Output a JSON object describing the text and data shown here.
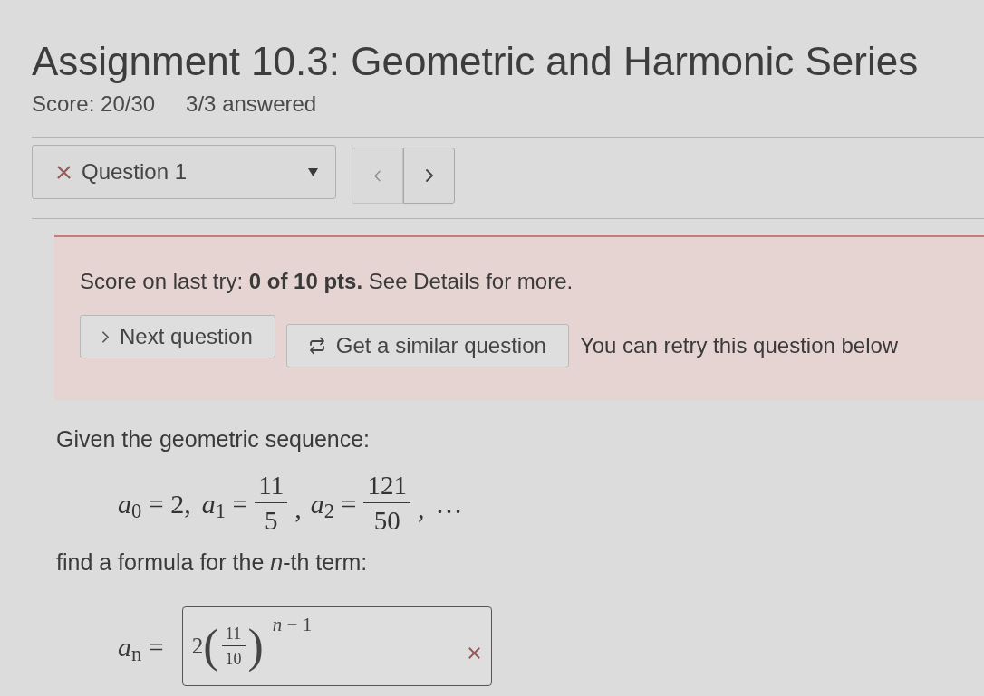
{
  "title": "Assignment 10.3: Geometric and Harmonic Series",
  "summary": {
    "score": "Score: 20/30",
    "answered": "3/3 answered"
  },
  "question_nav": {
    "label": "Question 1",
    "correct": false
  },
  "feedback": {
    "text": "Score on last try: **0 of 10 pts.** See Details for more.",
    "buttons": [
      {
        "kind": "next",
        "label": "Next question"
      },
      {
        "kind": "similar",
        "label": "Get a similar question"
      }
    ],
    "note": "You can retry this question below"
  },
  "question": {
    "intro": "Given the geometric sequence:",
    "terms": [
      {
        "kind": "integer",
        "text": "*a*$_{0}$ = 2,"
      },
      {
        "kind": "fraction",
        "lhs": "*a*$_{1}$ =",
        "numerator": "11",
        "denominator": "5",
        "trail": ","
      },
      {
        "kind": "fraction",
        "lhs": "*a*$_{2}$ =",
        "numerator": "121",
        "denominator": "50",
        "trail": ","
      }
    ],
    "continuation": "…",
    "prompt": "find a formula for the *n*-th term:",
    "answer": {
      "lhs": "*a*$_{n}$ =",
      "coefficient": "2",
      "open": "(",
      "numerator": "11",
      "denominator": "10",
      "close": ")",
      "exponent": "*n* − 1",
      "correct": false
    }
  }
}
